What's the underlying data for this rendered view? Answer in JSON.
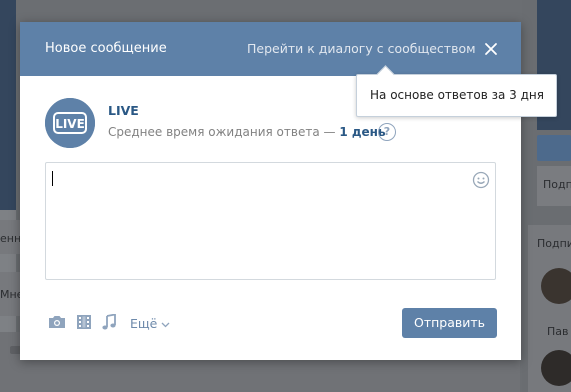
{
  "background": {
    "fragments": [
      "енн",
      "Мне",
      "Подп",
      "Подпи",
      "Пав"
    ]
  },
  "modal": {
    "title": "Новое сообщение",
    "goto_link": "Перейти к диалогу с сообществом",
    "close_icon": "close-icon",
    "header_color": "#5e81a8"
  },
  "community": {
    "logo_text": "LIVE",
    "name": "LIVE",
    "wait_prefix": "Среднее время ожидания ответа —",
    "wait_value": "1 день",
    "help_glyph": "?"
  },
  "tooltip": {
    "text": "На основе ответов за 3 дня"
  },
  "message": {
    "value": ""
  },
  "attachments": {
    "icons": [
      "camera-icon",
      "video-icon",
      "music-icon"
    ],
    "more_label": "Ещё"
  },
  "send_button": {
    "label": "Отправить",
    "color": "#5e81a8"
  }
}
